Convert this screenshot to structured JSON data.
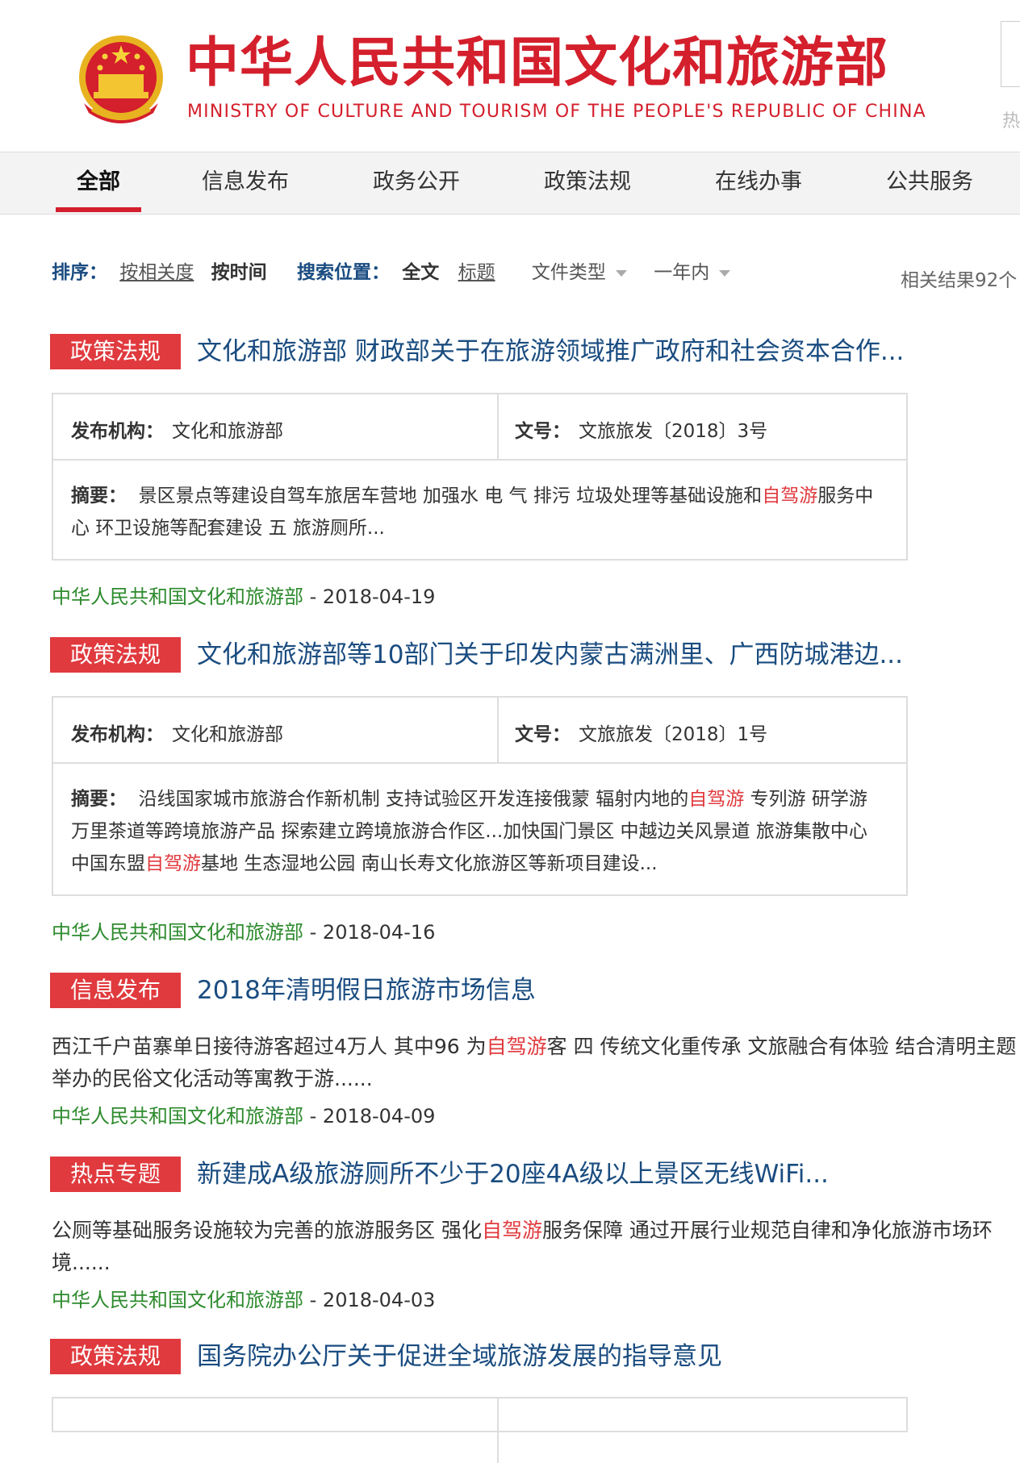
{
  "header": {
    "title_cn": "中华人民共和国文化和旅游部",
    "title_en": "MINISTRY OF CULTURE AND TOURISM OF THE PEOPLE'S REPUBLIC OF CHINA",
    "hot_label": "热"
  },
  "nav": {
    "items": [
      "全部",
      "信息发布",
      "政务公开",
      "政策法规",
      "在线办事",
      "公共服务"
    ],
    "active_index": 0
  },
  "filters": {
    "sort_label": "排序：",
    "sort_relevance": "按相关度",
    "sort_time": "按时间",
    "position_label": "搜索位置：",
    "position_full": "全文",
    "position_title": "标题",
    "filetype": "文件类型",
    "timerange": "一年内",
    "result_count": "相关结果92个"
  },
  "results": [
    {
      "tag": "政策法规",
      "title": "文化和旅游部 财政部关于在旅游领域推广政府和社会资本合作...",
      "publisher_label": "发布机构：",
      "publisher": "文化和旅游部",
      "docno_label": "文号：",
      "docno": "文旅旅发〔2018〕3号",
      "summary_label": "摘要：",
      "summary_1": "景区景点等建设自驾车旅居车营地 加强水 电 气 排污 垃圾处理等基础设施和",
      "summary_hl_1": "自驾游",
      "summary_2": "服务中心 环卫设施等配套建设 五 旅游厕所...",
      "source": "中华人民共和国文化和旅游部",
      "date": " - 2018-04-19"
    },
    {
      "tag": "政策法规",
      "title": "文化和旅游部等10部门关于印发内蒙古满洲里、广西防城港边...",
      "publisher_label": "发布机构：",
      "publisher": "文化和旅游部",
      "docno_label": "文号：",
      "docno": "文旅旅发〔2018〕1号",
      "summary_label": "摘要：",
      "summary_1": "沿线国家城市旅游合作新机制 支持试验区开发连接俄蒙 辐射内地的",
      "summary_hl_1": "自驾游",
      "summary_2": " 专列游 研学游 万里茶道等跨境旅游产品 探索建立跨境旅游合作区...加快国门景区 中越边关风景道 旅游集散中心 中国东盟",
      "summary_hl_2": "自驾游",
      "summary_3": "基地 生态湿地公园 南山长寿文化旅游区等新项目建设...",
      "source": "中华人民共和国文化和旅游部",
      "date": " - 2018-04-16"
    },
    {
      "tag": "信息发布",
      "title": "2018年清明假日旅游市场信息",
      "text_1": "西江千户苗寨单日接待游客超过4万人 其中96 为",
      "text_hl": "自驾游",
      "text_2": "客 四 传统文化重传承 文旅融合有体验 结合清明主题举办的民俗文化活动等寓教于游......",
      "source": "中华人民共和国文化和旅游部",
      "date": " - 2018-04-09"
    },
    {
      "tag": "热点专题",
      "title": "新建成A级旅游厕所不少于20座4A级以上景区无线WiFi...",
      "text_1": "公厕等基础服务设施较为完善的旅游服务区 强化",
      "text_hl": "自驾游",
      "text_2": "服务保障 通过开展行业规范自律和净化旅游市场环境......",
      "source": "中华人民共和国文化和旅游部",
      "date": " - 2018-04-03"
    },
    {
      "tag": "政策法规",
      "title": "国务院办公厅关于促进全域旅游发展的指导意见"
    }
  ],
  "colors": {
    "brand_red": "#d41f2c",
    "tag_red": "#e03a3e",
    "title_blue": "#1a4c80",
    "source_green": "#2e8b2e"
  }
}
